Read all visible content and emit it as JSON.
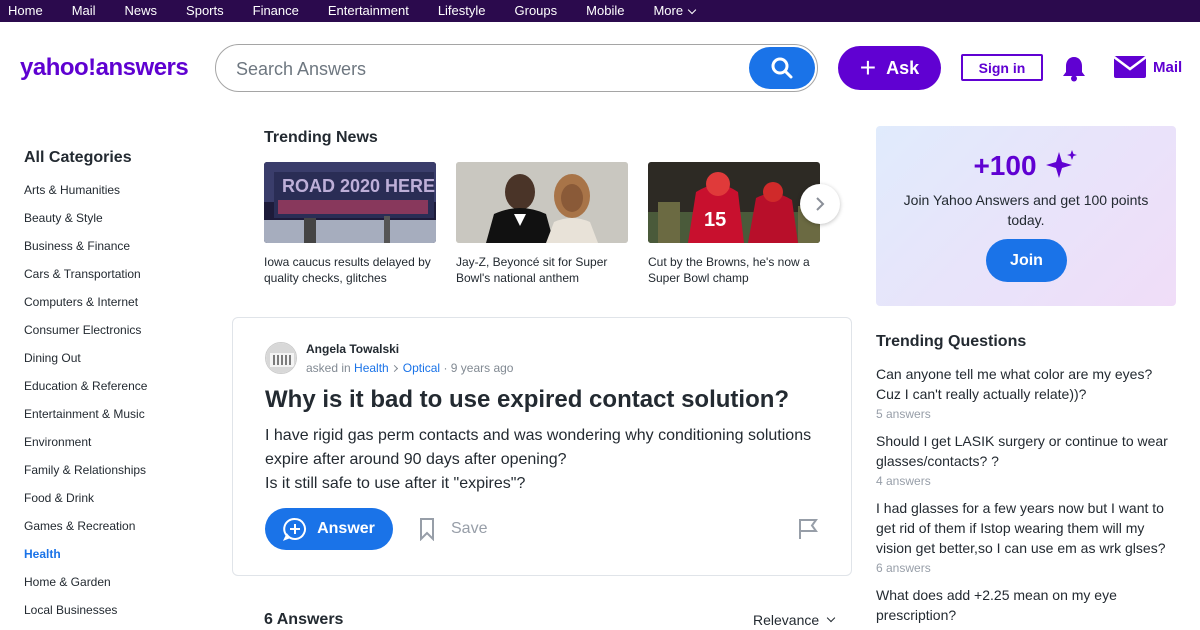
{
  "topnav": {
    "items": [
      "Home",
      "Mail",
      "News",
      "Sports",
      "Finance",
      "Entertainment",
      "Lifestyle",
      "Groups",
      "Mobile",
      "More"
    ]
  },
  "header": {
    "logo": "yahoo!answers",
    "search_placeholder": "Search Answers",
    "ask_label": "Ask",
    "signin_label": "Sign in",
    "mail_label": "Mail"
  },
  "sidebar": {
    "title": "All Categories",
    "categories": [
      "Arts & Humanities",
      "Beauty & Style",
      "Business & Finance",
      "Cars & Transportation",
      "Computers & Internet",
      "Consumer Electronics",
      "Dining Out",
      "Education & Reference",
      "Entertainment & Music",
      "Environment",
      "Family & Relationships",
      "Food & Drink",
      "Games & Recreation",
      "Health",
      "Home & Garden",
      "Local Businesses"
    ],
    "active": "Health"
  },
  "trending_news": {
    "title": "Trending News",
    "items": [
      {
        "caption": "Iowa caucus results delayed by quality checks, glitches",
        "image": "iowa-caucus-photo"
      },
      {
        "caption": "Jay-Z, Beyoncé sit for Super Bowl's national anthem",
        "image": "jayz-beyonce-photo"
      },
      {
        "caption": "Cut by the Browns, he's now a Super Bowl champ",
        "image": "chiefs-celebration-photo"
      }
    ]
  },
  "question": {
    "author": "Angela Towalski",
    "asked_in": "asked in",
    "category": "Health",
    "subcategory": "Optical",
    "time": "· 9 years ago",
    "title": "Why is it bad to use expired contact solution?",
    "body_lines": [
      "I have rigid gas perm contacts and was wondering why conditioning solutions expire after around 90 days after opening?",
      "Is it still safe to use after it \"expires\"?"
    ],
    "answer_label": "Answer",
    "save_label": "Save"
  },
  "answers": {
    "count_label": "6 Answers",
    "sort_label": "Relevance"
  },
  "promo": {
    "points": "+100",
    "text": "Join Yahoo Answers and get 100 points today.",
    "join_label": "Join"
  },
  "trending_questions": {
    "title": "Trending Questions",
    "items": [
      {
        "q": "Can anyone tell me what color are my eyes? Cuz I can't really actually relate))?",
        "a": "5 answers"
      },
      {
        "q": "Should I get LASIK surgery or continue to wear glasses/contacts? ?",
        "a": "4 answers"
      },
      {
        "q": "I had glasses for a few years now but I want to get rid of them if Istop wearing them will my vision get better,so I can use em as wrk glses?",
        "a": "6 answers"
      },
      {
        "q": "What does add +2.25 mean on my eye prescription?",
        "a": ""
      }
    ]
  },
  "colors": {
    "nav_bg": "#2b0a4d",
    "brand_purple": "#6001d2",
    "accent_blue": "#1a73e8"
  }
}
